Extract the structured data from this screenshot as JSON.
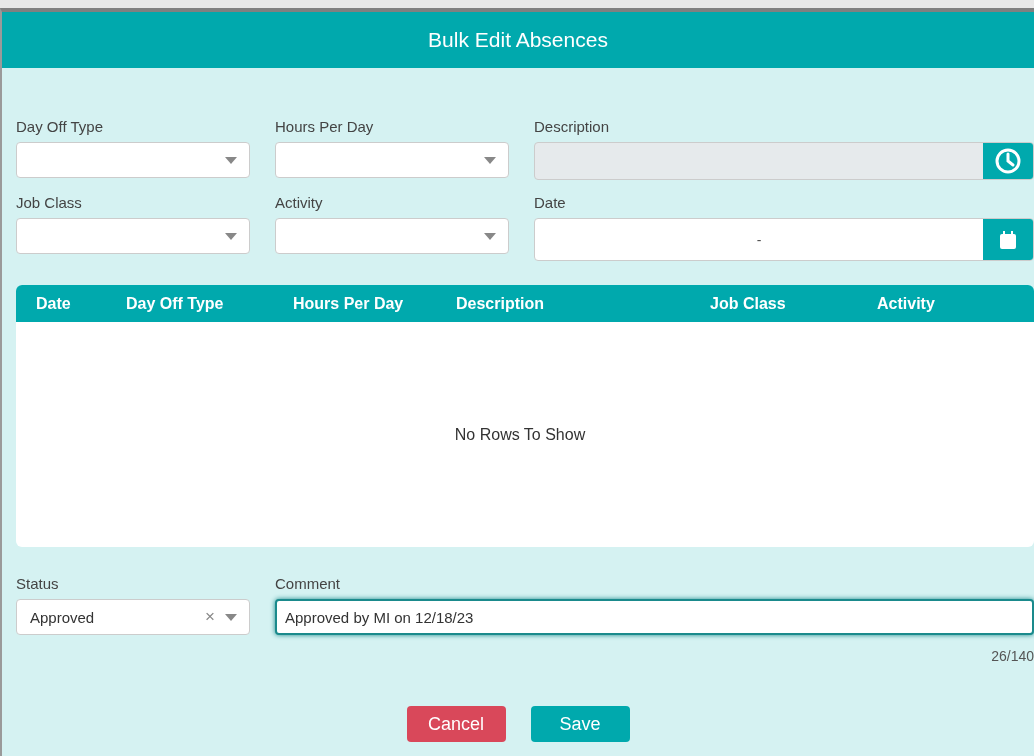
{
  "dialog": {
    "title": "Bulk Edit Absences"
  },
  "fields": [
    {
      "label": "Day Off Type",
      "kind": "select",
      "disabled": false
    },
    {
      "label": "Hours Per Day",
      "kind": "select",
      "disabled": false
    },
    {
      "label": "Description",
      "kind": "clock",
      "disabled": true
    },
    {
      "label": "Job Class",
      "kind": "select",
      "disabled": false
    },
    {
      "label": "Activity",
      "kind": "select",
      "disabled": false
    },
    {
      "label": "Date",
      "kind": "date",
      "disabled": false,
      "value": "-"
    }
  ],
  "table": {
    "columns": [
      "Date",
      "Day Off Type",
      "Hours Per Day",
      "Description",
      "Job Class",
      "Activity"
    ],
    "empty_message": "No Rows To Show"
  },
  "status": {
    "label": "Status",
    "value": "Approved",
    "clear": "×"
  },
  "comment": {
    "label": "Comment",
    "value": "Approved by MI on 12/18/23",
    "focused": true,
    "counter": "26/140"
  },
  "buttons": [
    {
      "label": "Cancel",
      "kind": "danger"
    },
    {
      "label": "Save",
      "kind": "primary"
    }
  ]
}
